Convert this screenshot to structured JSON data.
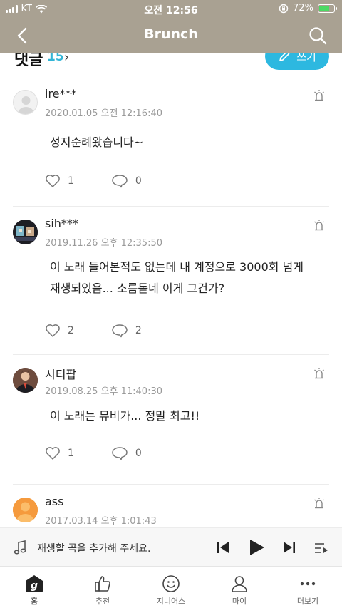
{
  "status_bar": {
    "carrier": "KT",
    "time": "오전 12:56",
    "battery": "72%",
    "battery_level": 0.72
  },
  "header": {
    "title": "Brunch"
  },
  "comment_section": {
    "label": "댓글",
    "count": "15",
    "write_label": "쓰기"
  },
  "comments": [
    {
      "user": "ire***",
      "date": "2020.01.05 오전 12:16:40",
      "text": "성지순례왔습니다~",
      "likes": "1",
      "replies": "0"
    },
    {
      "user": "sih***",
      "date": "2019.11.26 오후 12:35:50",
      "text": "이 노래 들어본적도 없는데 내 계정으로 3000회 넘게 재생되있음... 소름돋네 이게 그건가?",
      "likes": "2",
      "replies": "2"
    },
    {
      "user": "시티팝",
      "date": "2019.08.25 오후 11:40:30",
      "text": "이 노래는 뮤비가... 정말 최고!!",
      "likes": "1",
      "replies": "0"
    },
    {
      "user": "ass",
      "date": "2017.03.14 오후 1:01:43",
      "text": "",
      "likes": "",
      "replies": ""
    }
  ],
  "player": {
    "text": "재생할 곡을 추가해 주세요."
  },
  "tabs": [
    {
      "label": "홈",
      "icon": "genie-home-icon"
    },
    {
      "label": "추천",
      "icon": "thumbs-up-icon"
    },
    {
      "label": "지니어스",
      "icon": "smile-icon"
    },
    {
      "label": "마이",
      "icon": "person-icon"
    },
    {
      "label": "더보기",
      "icon": "more-dots-icon"
    }
  ],
  "colors": {
    "header": "#a9a192",
    "accent": "#2db8e0",
    "count": "#33b5d6"
  }
}
